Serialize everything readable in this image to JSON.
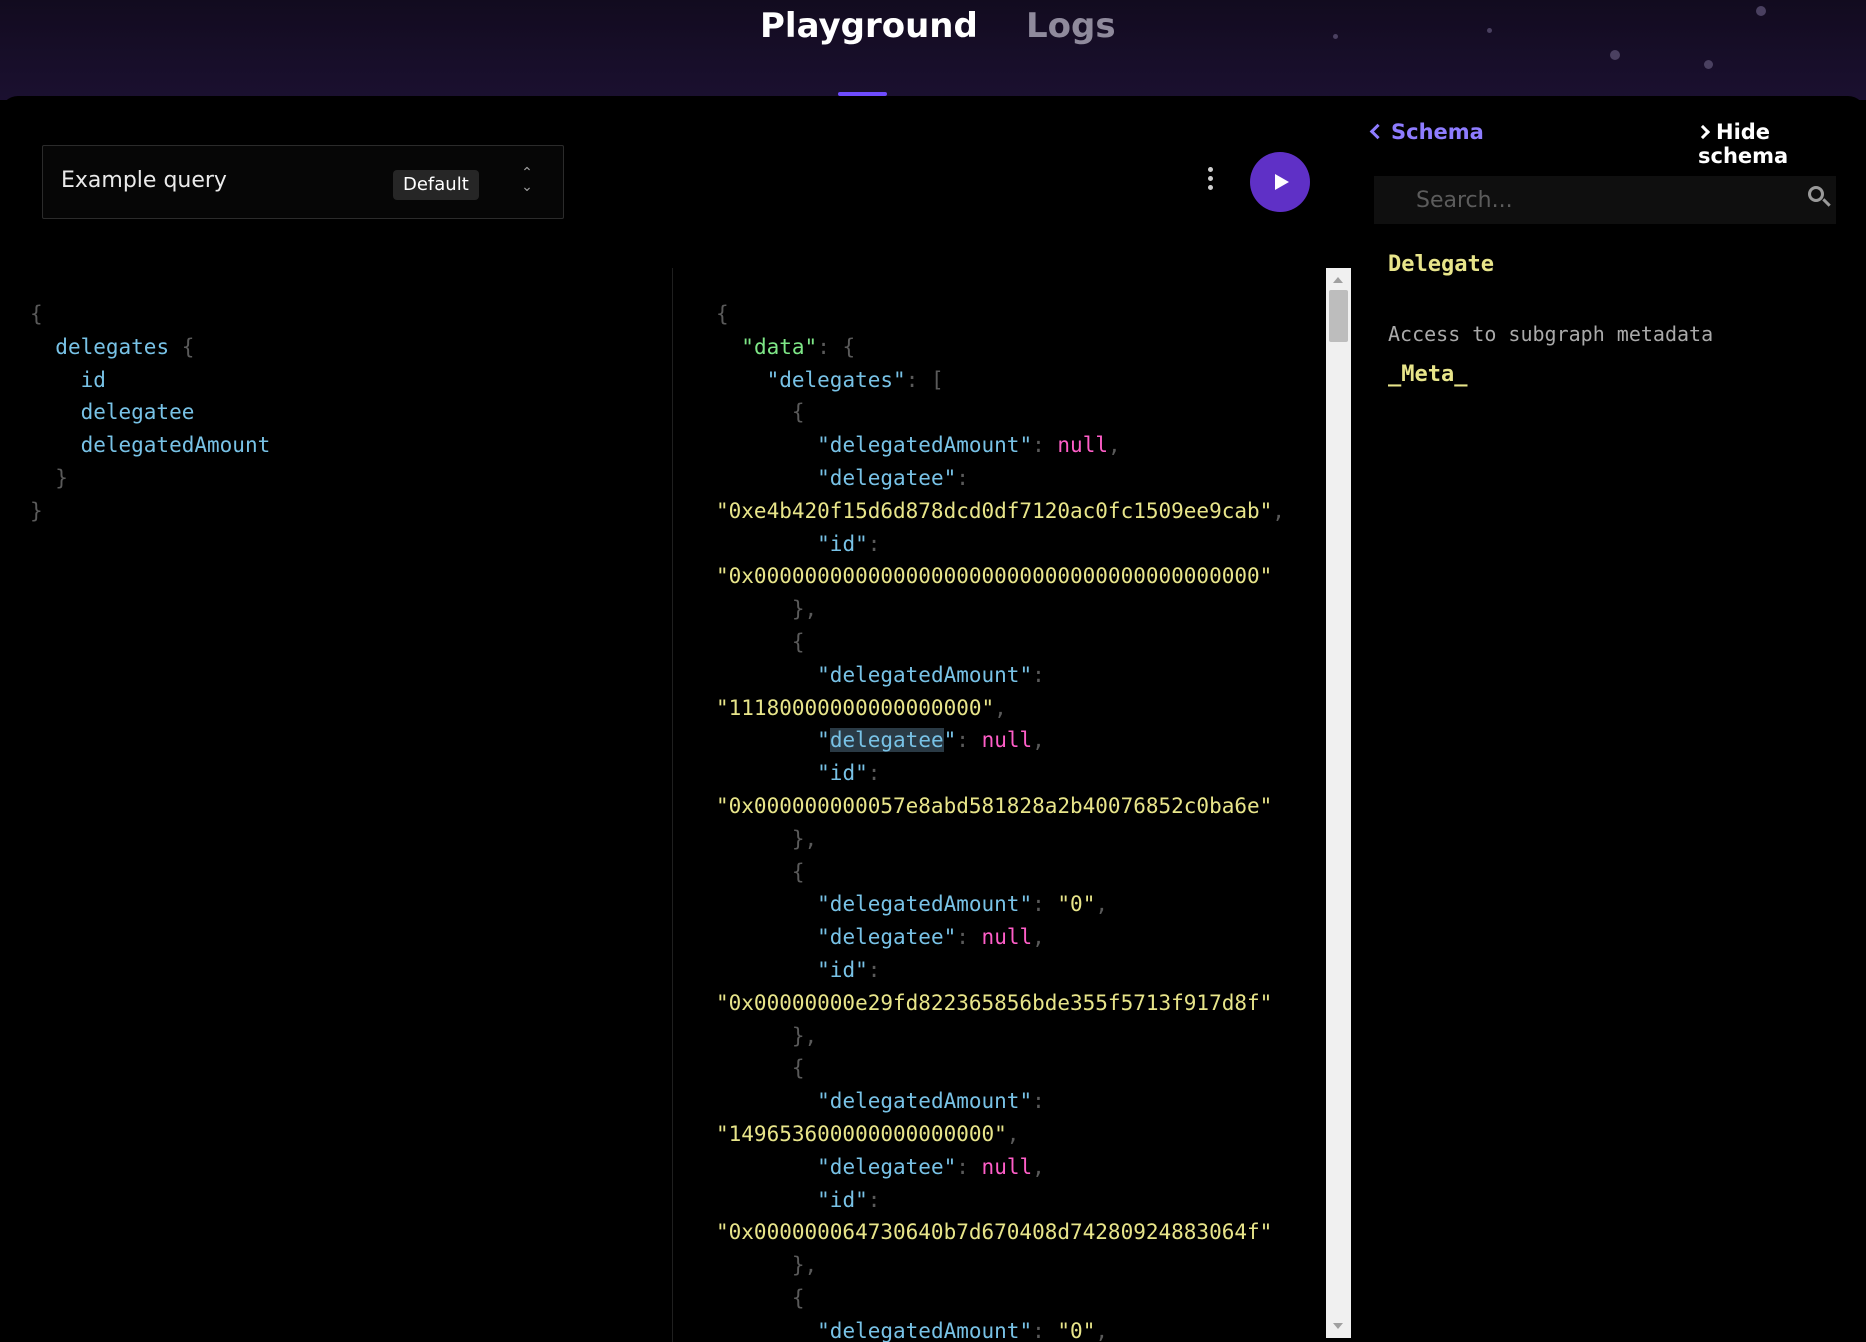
{
  "header": {
    "tabs": [
      {
        "label": "Playground",
        "active": true
      },
      {
        "label": "Logs",
        "active": false
      }
    ]
  },
  "query_selector": {
    "name": "Example query",
    "badge": "Default"
  },
  "toolbar": {
    "more_icon": "vertical-ellipsis-icon",
    "run_icon": "play-icon"
  },
  "schema": {
    "back_label": "Schema",
    "hide_label": "Hide schema",
    "search_placeholder": "Search...",
    "type_name": "Delegate",
    "description": "Access to subgraph metadata",
    "field": "_Meta_"
  },
  "query": {
    "root_field": "delegates",
    "fields": [
      "id",
      "delegatee",
      "delegatedAmount"
    ]
  },
  "result": {
    "data_key": "data",
    "list_key": "delegates",
    "entries": [
      {
        "delegatedAmount": "null",
        "delegatee": "\"0xe4b420f15d6d878dcd0df7120ac0fc1509ee9cab\"",
        "id": "\"0x0000000000000000000000000000000000000000\""
      },
      {
        "delegatedAmount": "\"11180000000000000000\"",
        "delegatee": "null",
        "id": "\"0x000000000057e8abd581828a2b40076852c0ba6e\""
      },
      {
        "delegatedAmount": "\"0\"",
        "delegatee": "null",
        "id": "\"0x00000000e29fd822365856bde355f5713f917d8f\""
      },
      {
        "delegatedAmount": "\"149653600000000000000\"",
        "delegatee": "null",
        "id": "\"0x000000064730640b7d670408d74280924883064f\""
      },
      {
        "delegatedAmount": "\"0\""
      }
    ]
  },
  "colors": {
    "accent": "#6f4cff",
    "run_button": "#5f30c6",
    "key": "#78c2e6",
    "string": "#e8e58a",
    "null": "#ff5ec8"
  }
}
